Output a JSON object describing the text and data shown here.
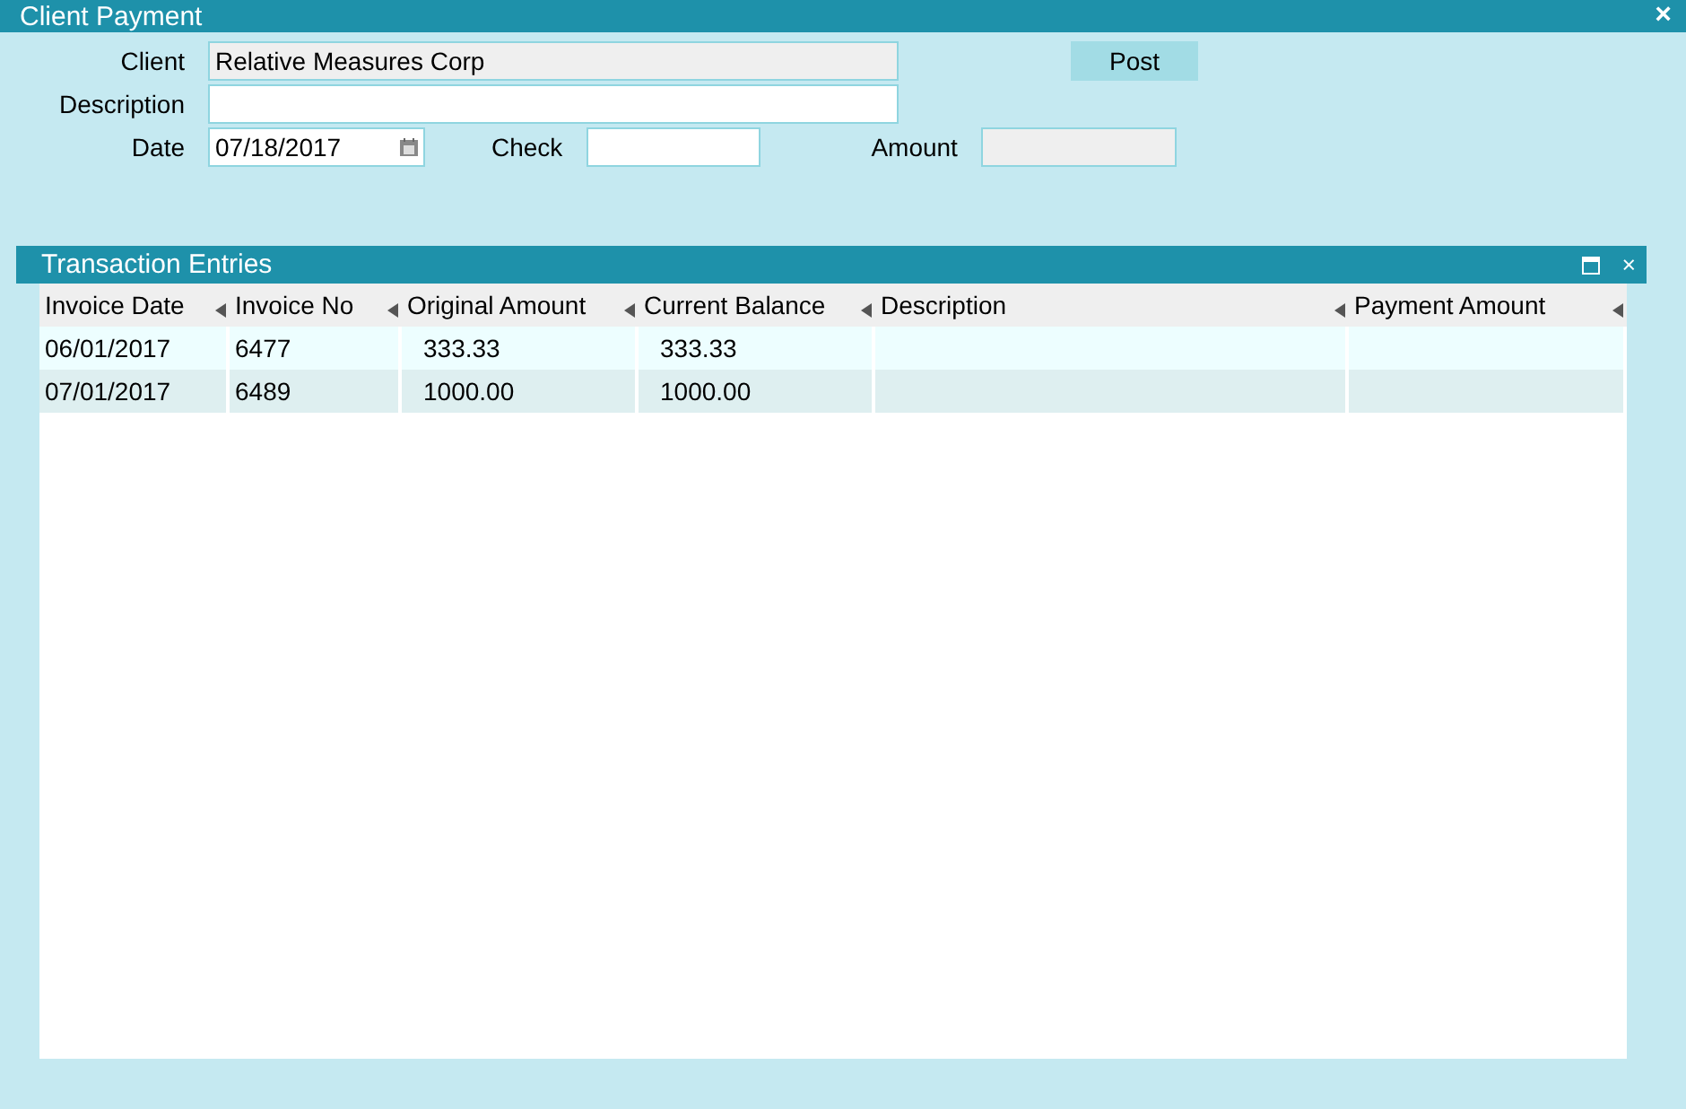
{
  "window": {
    "title": "Client Payment",
    "close": "×"
  },
  "form": {
    "client": {
      "label": "Client",
      "value": "Relative Measures Corp",
      "disabled": true
    },
    "description": {
      "label": "Description",
      "disabled": false
    },
    "date": {
      "label": "Date",
      "value": "07/18/2017"
    },
    "check": {
      "label": "Check",
      "disabled": false
    },
    "amount": {
      "label": "Amount",
      "disabled": true
    },
    "post_button": "Post"
  },
  "panel": {
    "title": "Transaction Entries",
    "close": "×",
    "columns": [
      "Invoice Date",
      "Invoice No",
      "Original Amount",
      "Current Balance",
      "Description",
      "Payment Amount"
    ],
    "rows": [
      [
        "06/01/2017",
        "6477",
        "333.33",
        "333.33",
        "",
        ""
      ],
      [
        "07/01/2017",
        "6489",
        "1000.00",
        "1000.00",
        "",
        ""
      ]
    ]
  }
}
